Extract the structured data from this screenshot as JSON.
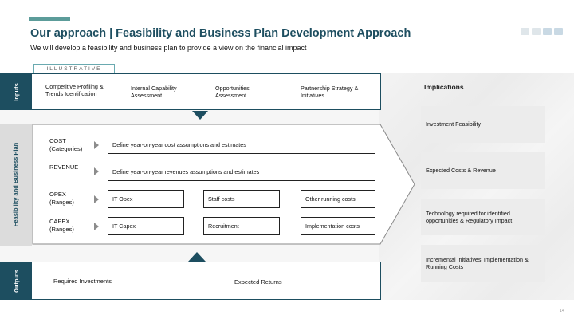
{
  "header": {
    "title": "Our approach | Feasibility and Business Plan Development Approach",
    "subtitle": "We will develop a feasibility and business plan to provide a view on the financial impact",
    "tag": "ILLUSTRATIVE"
  },
  "tabs": {
    "inputs": "Inputs",
    "feasibility": "Feasibility and Business Plan",
    "outputs": "Outputs"
  },
  "inputs": [
    "Competitive Profiling & Trends Identification",
    "Internal Capability Assessment",
    "Opportunities Assessment",
    "Partnership Strategy & Initiatives"
  ],
  "plan_rows": {
    "cost": {
      "label": "COST (Categories)",
      "cells": [
        "Define year-on-year cost assumptions and estimates"
      ]
    },
    "revenue": {
      "label": "REVENUE",
      "cells": [
        "Define year-on-year revenues assumptions and estimates"
      ]
    },
    "opex": {
      "label": "OPEX (Ranges)",
      "cells": [
        "IT Opex",
        "Staff costs",
        "Other running costs"
      ]
    },
    "capex": {
      "label": "CAPEX (Ranges)",
      "cells": [
        "IT Capex",
        "Recruitment",
        "Implementation costs"
      ]
    }
  },
  "outputs": [
    "Required Investments",
    "Expected Returns"
  ],
  "implications": {
    "title": "Implications",
    "items": [
      "Investment Feasibility",
      "Expected Costs & Revenue",
      "Technology required for identified opportunities & Regulatory Impact",
      "Incremental Initiatives' Implementation & Running Costs"
    ]
  },
  "page_number": "14",
  "colors": {
    "primary": "#1d4e60",
    "accent": "#5c9c9a",
    "card": "#ececec"
  }
}
